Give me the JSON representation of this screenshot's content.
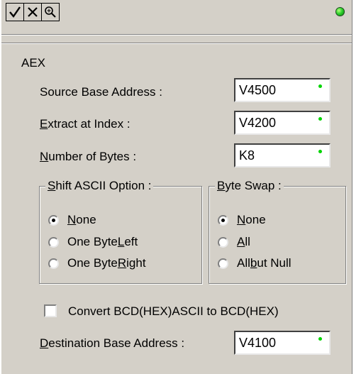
{
  "toolbar": {
    "buttons": [
      {
        "icon": "check-icon"
      },
      {
        "icon": "x-icon"
      },
      {
        "icon": "magnify-icon"
      }
    ]
  },
  "status_led_color": "#2fd12f",
  "section_title": "AEX",
  "fields": {
    "source_base": {
      "label": "Source Base Address :",
      "value": "V4500"
    },
    "extract_index": {
      "label_accel": "E",
      "label_rest": "xtract at Index :",
      "value": "V4200"
    },
    "num_bytes": {
      "label_accel": "N",
      "label_rest": "umber of Bytes :",
      "value": "K8"
    },
    "destination": {
      "label_accel": "D",
      "label_rest": "estination Base Address :",
      "value": "V4100"
    }
  },
  "shift_group": {
    "title_accel": "S",
    "title_rest": "hift ASCII Option :",
    "options": [
      {
        "pre": "",
        "accel": "N",
        "post": "one",
        "selected": true
      },
      {
        "pre": "One Byte ",
        "accel": "L",
        "post": "eft",
        "selected": false
      },
      {
        "pre": "One Byte ",
        "accel": "R",
        "post": "ight",
        "selected": false
      }
    ]
  },
  "swap_group": {
    "title_accel": "B",
    "title_rest": "yte Swap :",
    "options": [
      {
        "pre": "",
        "accel": "N",
        "post": "one",
        "selected": true
      },
      {
        "pre": "",
        "accel": "A",
        "post": "ll",
        "selected": false
      },
      {
        "pre": "All ",
        "accel": "b",
        "post": "ut Null",
        "selected": false
      }
    ]
  },
  "convert_checkbox": {
    "label": "Convert BCD(HEX)ASCII to BCD(HEX)",
    "checked": false
  },
  "indicator_dot_color": "#00d400"
}
